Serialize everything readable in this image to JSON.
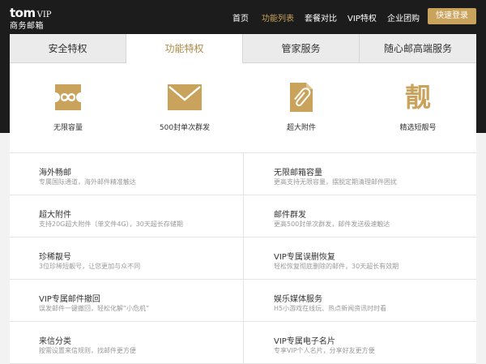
{
  "logo": {
    "brand": "tom",
    "vip": "VIP",
    "sub": "商务邮箱"
  },
  "nav": {
    "items": [
      "首页",
      "功能列表",
      "套餐对比",
      "VIP特权",
      "企业团购"
    ],
    "active": "功能列表",
    "login": "快速登录"
  },
  "tabs": [
    "安全特权",
    "功能特权",
    "管家服务",
    "随心邮高端服务"
  ],
  "active_tab": "功能特权",
  "features": [
    {
      "label": "无限容量",
      "icon": "infinity-icon"
    },
    {
      "label": "500封单次群发",
      "icon": "envelope-icon"
    },
    {
      "label": "超大附件",
      "icon": "attachment-icon"
    },
    {
      "label": "精选短靓号",
      "icon": "liang-char-icon",
      "glyph": "靓"
    }
  ],
  "list": [
    {
      "title": "海外畅邮",
      "desc": "专属国际通道，海外邮件精准触达"
    },
    {
      "title": "无限邮箱容量",
      "desc": "更高支持无限容量，摆脱定期清理邮件困扰"
    },
    {
      "title": "超大附件",
      "desc": "支持20G超大附件（单文件4G），30天超长存储期"
    },
    {
      "title": "邮件群发",
      "desc": "更高500封单次群发，邮件发送极速触达"
    },
    {
      "title": "珍稀靓号",
      "desc": "3位珍稀短靓号，让您更加与众不同"
    },
    {
      "title": "VIP专属误删恢复",
      "desc": "轻松恢复彻底删除的邮件，30天超长有效期"
    },
    {
      "title": "VIP专属邮件撤回",
      "desc": "误发邮件一键撤回，轻松化解“小危机”"
    },
    {
      "title": "娱乐媒体服务",
      "desc": "H5小游戏在线玩、热点新闻资讯时时看"
    },
    {
      "title": "来信分类",
      "desc": "按需设置来信规则，找邮件更方便"
    },
    {
      "title": "VIP专属电子名片",
      "desc": "专享VIP个人名片，分享好友更方便"
    }
  ],
  "colors": {
    "gold": "#c9a25b",
    "dark": "#1c1c1c"
  }
}
